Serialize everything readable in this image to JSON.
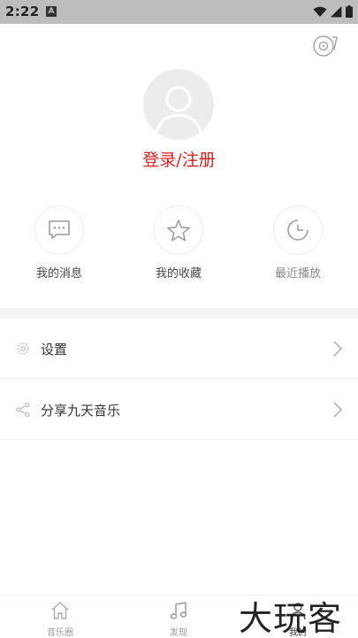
{
  "status_bar": {
    "time": "2:22",
    "notification_glyph": "A",
    "icons": [
      "wifi-icon",
      "signal-icon",
      "battery-icon"
    ]
  },
  "header": {
    "disc_icon": "vinyl-disc-icon"
  },
  "profile": {
    "login_text": "登录/注册"
  },
  "shortcuts": [
    {
      "label": "我的消息",
      "icon": "message-icon"
    },
    {
      "label": "我的收藏",
      "icon": "star-icon"
    },
    {
      "label": "最近播放",
      "icon": "clock-icon"
    }
  ],
  "menu": [
    {
      "label": "设置",
      "icon": "gear-icon"
    },
    {
      "label": "分享九天音乐",
      "icon": "share-icon"
    }
  ],
  "tabbar": {
    "tabs": [
      {
        "label": "音乐圈",
        "icon": "home-icon"
      },
      {
        "label": "发现",
        "icon": "music-note-icon"
      },
      {
        "label": "我的",
        "icon": "person-icon",
        "active": true
      }
    ]
  },
  "watermark": "大玩客",
  "colors": {
    "accent": "#e0201e",
    "status_bar": "#bdbdbd"
  }
}
